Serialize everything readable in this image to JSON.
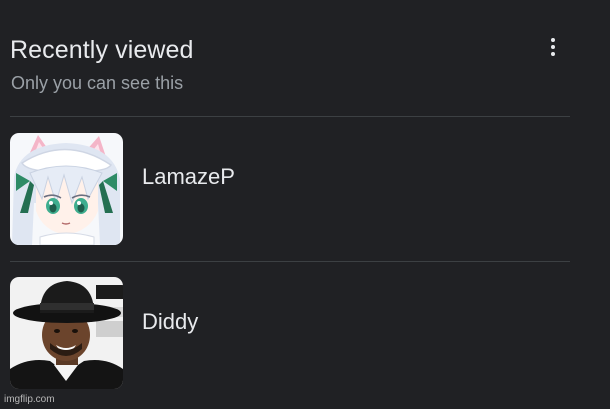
{
  "header": {
    "title": "Recently viewed",
    "subtitle": "Only you can see this",
    "menu_icon": "more-vertical-icon"
  },
  "items": [
    {
      "name": "LamazeP",
      "avatar": "anime-girl-avatar"
    },
    {
      "name": "Diddy",
      "avatar": "man-in-hat-avatar"
    }
  ],
  "watermark": "imgflip.com",
  "colors": {
    "background": "#202124",
    "primary_text": "#e8eaed",
    "secondary_text": "#9aa0a6",
    "divider": "#3c4043"
  }
}
